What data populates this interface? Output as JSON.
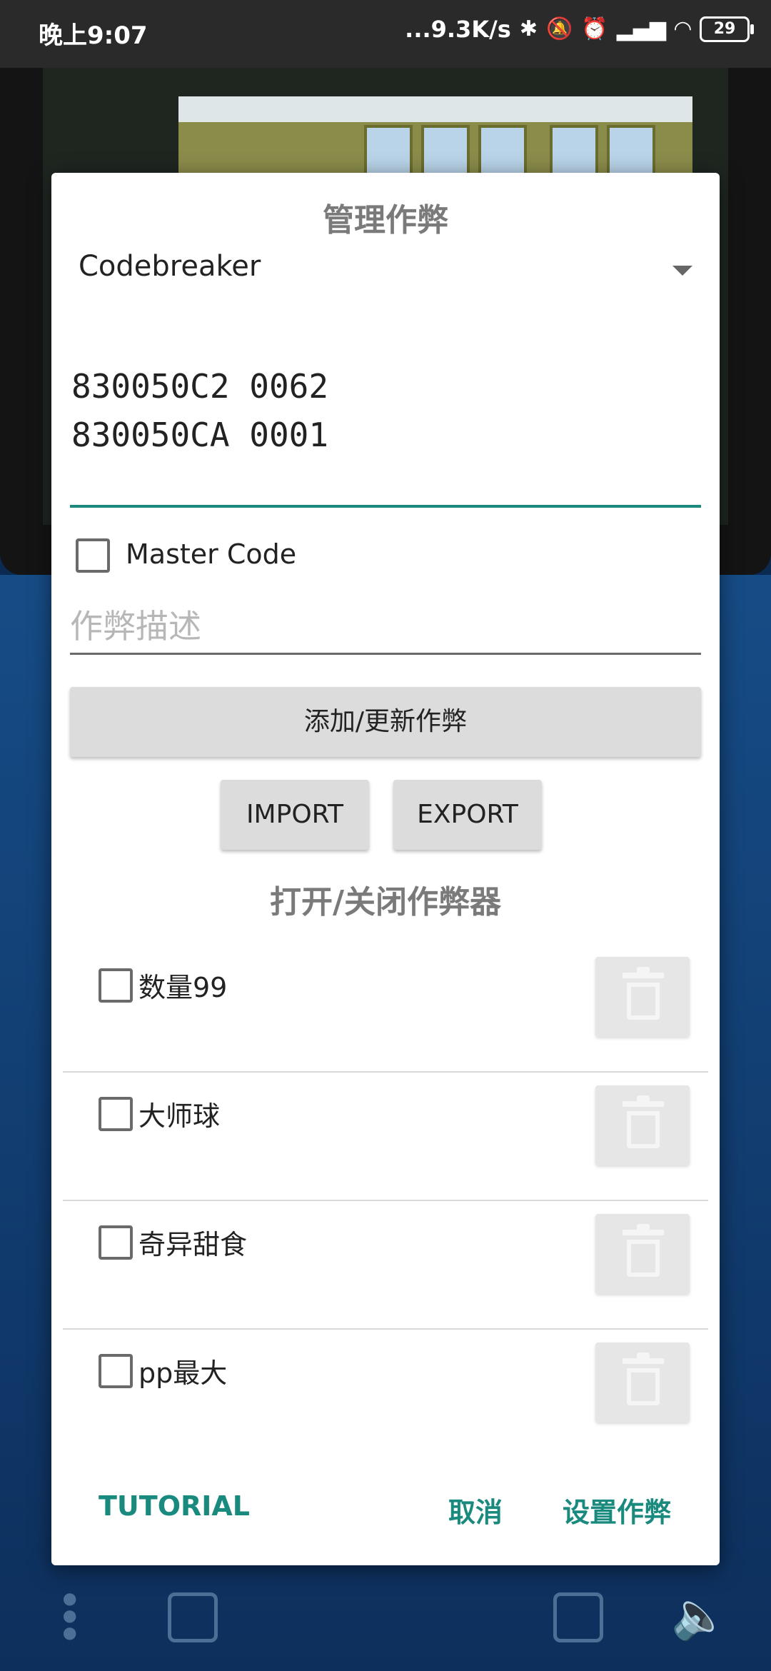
{
  "status_bar": {
    "time": "晚上9:07",
    "network_speed": "...9.3K/s",
    "battery": "29"
  },
  "dialog": {
    "title": "管理作弊",
    "code_type": "Codebreaker",
    "code_lines": [
      "830050C2 0062",
      "830050CA 0001"
    ],
    "master_code_label": "Master Code",
    "master_code_checked": false,
    "description_placeholder": "作弊描述",
    "description_value": "",
    "add_update_button": "添加/更新作弊",
    "import_button": "IMPORT",
    "export_button": "EXPORT",
    "toggle_section_title": "打开/关闭作弊器",
    "cheats": [
      {
        "label": "数量99",
        "checked": false
      },
      {
        "label": "大师球",
        "checked": false
      },
      {
        "label": "奇异甜食",
        "checked": false
      },
      {
        "label": "pp最大",
        "checked": false
      }
    ],
    "tutorial_button": "TUTORIAL",
    "cancel_button": "取消",
    "set_cheats_button": "设置作弊"
  },
  "colors": {
    "accent": "#1a8a7e",
    "title_gray": "#7a7a7a"
  },
  "icons": {
    "delete": "trash-icon",
    "dropdown": "chevron-down-icon"
  }
}
